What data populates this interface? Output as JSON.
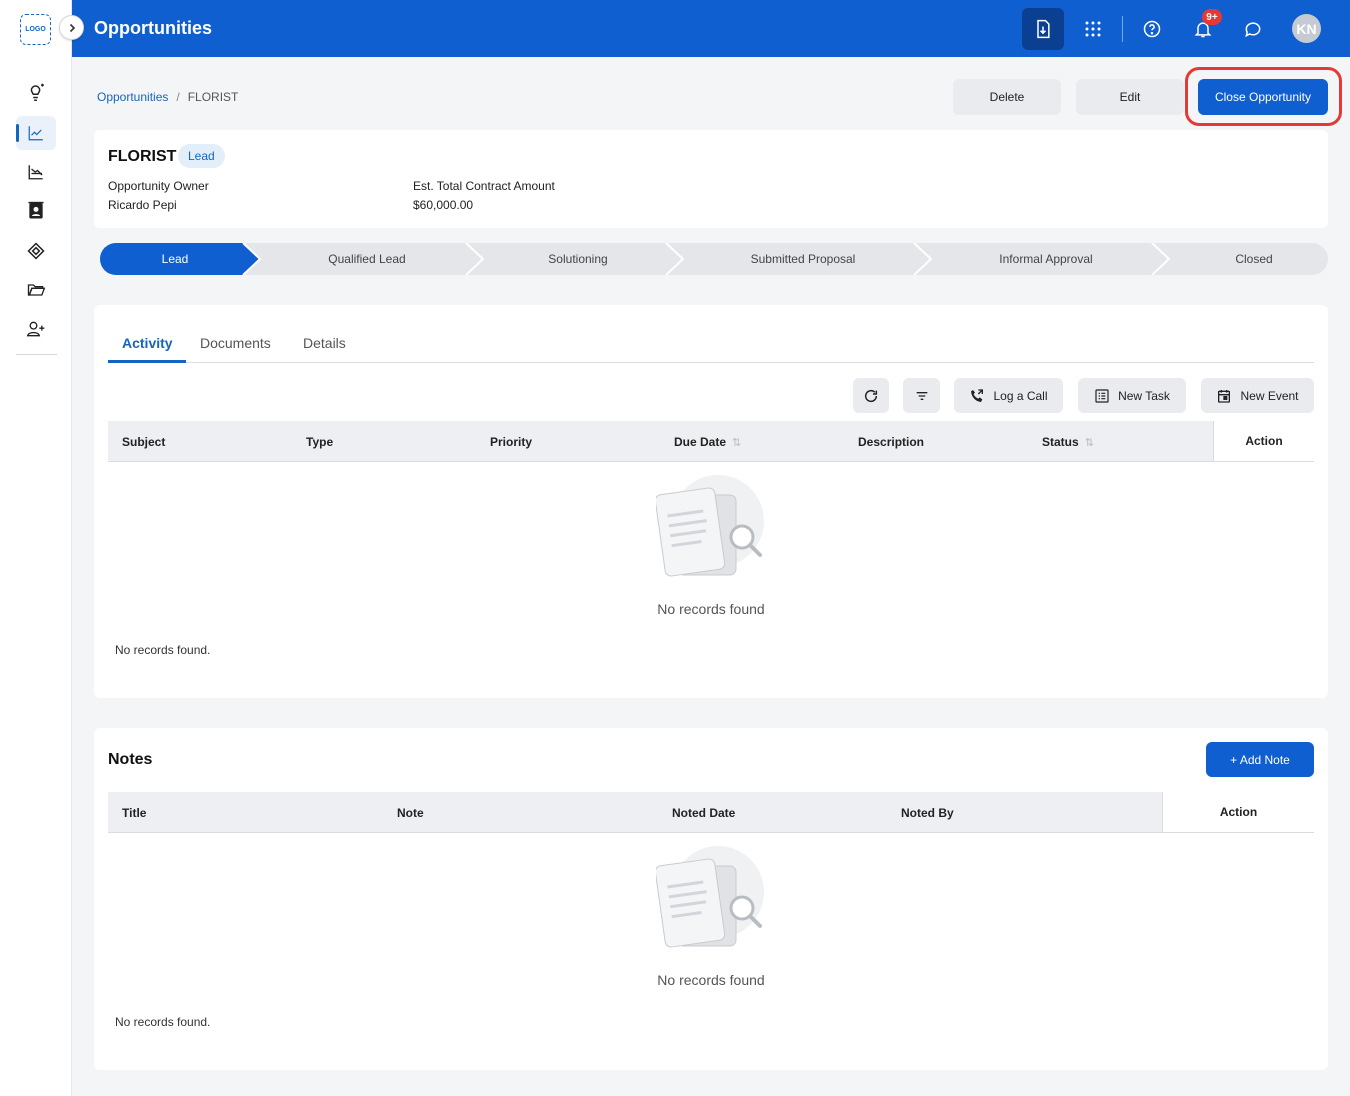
{
  "sidebar": {
    "logo_text": "LOGO",
    "items": [
      "lightbulb-icon",
      "trending-up-icon",
      "chart-decline-icon",
      "contacts-icon",
      "tag-icon",
      "folder-icon",
      "add-user-icon"
    ]
  },
  "header": {
    "title": "Opportunities",
    "notification_count": "9+",
    "avatar_initials": "KN"
  },
  "breadcrumb": {
    "root": "Opportunities",
    "separator": "/",
    "current": "FLORIST"
  },
  "actions": {
    "delete": "Delete",
    "edit": "Edit",
    "close_opportunity": "Close Opportunity"
  },
  "summary": {
    "name": "FLORIST",
    "stage_badge": "Lead",
    "owner_label": "Opportunity Owner",
    "owner_value": "Ricardo Pepi",
    "amount_label": "Est. Total Contract Amount",
    "amount_value": "$60,000.00"
  },
  "stages": [
    "Lead",
    "Qualified Lead",
    "Solutioning",
    "Submitted Proposal",
    "Informal Approval",
    "Closed"
  ],
  "active_stage": "Lead",
  "tabs": [
    "Activity",
    "Documents",
    "Details"
  ],
  "active_tab": "Activity",
  "activity": {
    "toolbar": {
      "log_call": "Log a Call",
      "new_task": "New Task",
      "new_event": "New Event"
    },
    "columns": [
      "Subject",
      "Type",
      "Priority",
      "Due Date",
      "Description",
      "Status"
    ],
    "action_column": "Action",
    "empty_message": "No records found",
    "footer_message": "No records found."
  },
  "notes": {
    "title": "Notes",
    "add_button": "+ Add Note",
    "columns": [
      "Title",
      "Note",
      "Noted Date",
      "Noted By"
    ],
    "action_column": "Action",
    "empty_message": "No records found",
    "footer_message": "No records found."
  },
  "colors": {
    "primary": "#0f5fd0",
    "highlight": "#e53935",
    "badge_bg": "#e3eefb"
  }
}
